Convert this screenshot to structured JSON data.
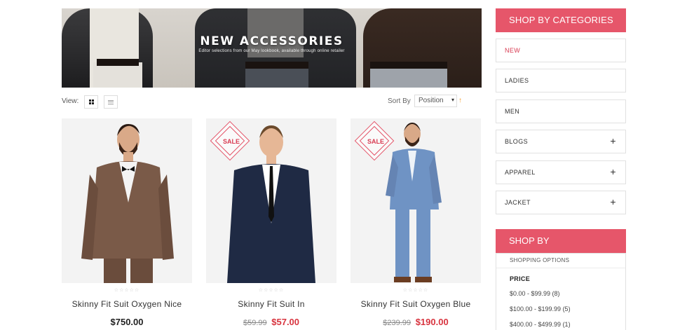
{
  "banner": {
    "title": "NEW ACCESSORIES",
    "subtitle": "Editor selections from our May lookbook, available through online retailer"
  },
  "toolbar": {
    "view_label": "View:",
    "grid_icon": "grid-view-icon",
    "list_icon": "list-view-icon",
    "sort_label": "Sort By",
    "sort_value": "Position",
    "sort_direction_icon": "arrow-up-icon"
  },
  "products": [
    {
      "name": "Skinny Fit Suit Oxygen Nice",
      "price": "$750.00",
      "old_price": "",
      "sale": false,
      "rating": "☆☆☆☆☆",
      "jacket_color": "#7a5a48"
    },
    {
      "name": "Skinny Fit Suit In",
      "price": "$57.00",
      "old_price": "$59.99",
      "sale": true,
      "sale_label": "SALE",
      "rating": "☆☆☆☆☆",
      "jacket_color": "#1f2a44"
    },
    {
      "name": "Skinny Fit Suit Oxygen Blue",
      "price": "$190.00",
      "old_price": "$239.99",
      "sale": true,
      "sale_label": "SALE",
      "rating": "☆☆☆☆☆",
      "jacket_color": "#6f93c4"
    }
  ],
  "sidebar": {
    "categories_title": "SHOP BY CATEGORIES",
    "categories": [
      {
        "label": "NEW",
        "active": true,
        "expandable": false
      },
      {
        "label": "LADIES",
        "active": false,
        "expandable": false
      },
      {
        "label": "MEN",
        "active": false,
        "expandable": false
      },
      {
        "label": "BLOGS",
        "active": false,
        "expandable": true
      },
      {
        "label": "APPAREL",
        "active": false,
        "expandable": true
      },
      {
        "label": "JACKET",
        "active": false,
        "expandable": true
      }
    ],
    "expand_symbol": "+",
    "shop_by_title": "SHOP BY",
    "shopping_options": "SHOPPING OPTIONS",
    "price_label": "PRICE",
    "price_ranges": [
      "$0.00 - $99.99 (8)",
      "$100.00 - $199.99 (5)",
      "$400.00 - $499.99 (1)"
    ]
  },
  "colors": {
    "accent": "#e6566a",
    "sale_price": "#d8343f",
    "sort_arrow": "#f39a2a"
  }
}
